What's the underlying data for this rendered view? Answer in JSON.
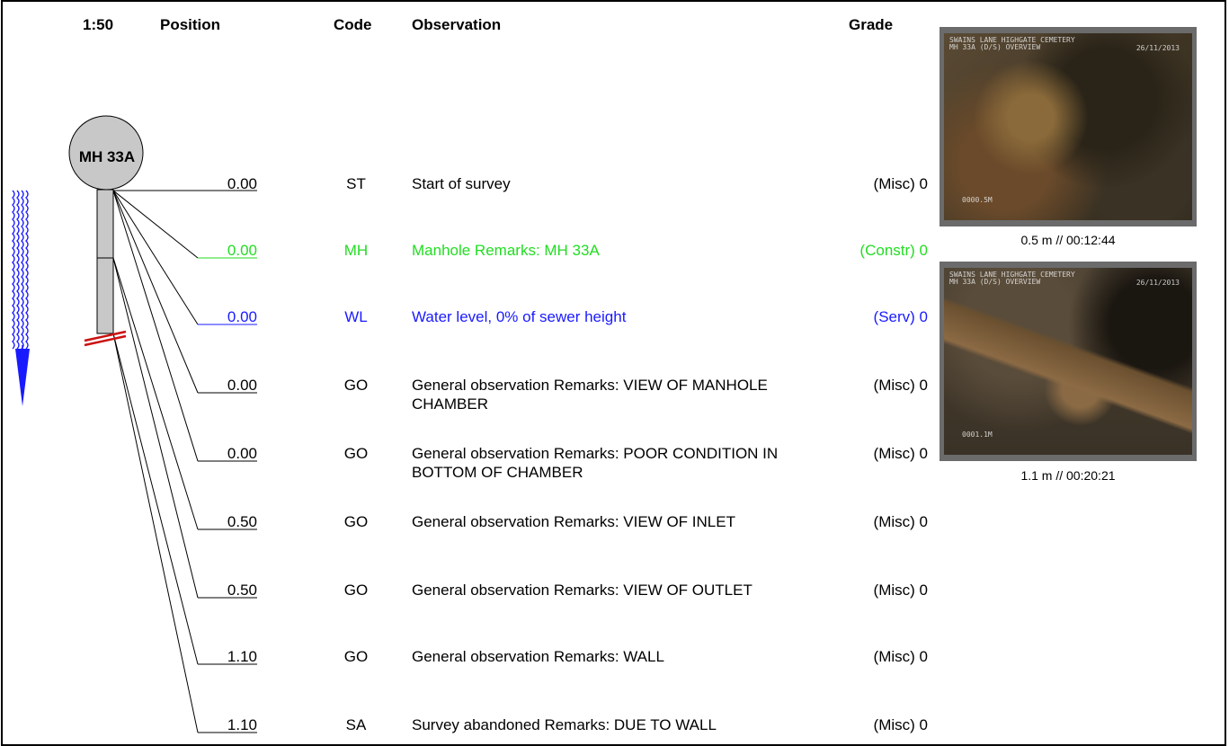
{
  "header": {
    "scale": "1:50",
    "position": "Position",
    "code": "Code",
    "observation": "Observation",
    "grade": "Grade"
  },
  "manhole": {
    "label": "MH 33A"
  },
  "colors": {
    "default": "#000000",
    "constr": "#22dd22",
    "serv": "#1a1aff",
    "flow_arrow": "#1a1aff",
    "pipe_fill": "#c8c8c8",
    "abandon_mark": "#cc1111"
  },
  "rows": [
    {
      "position": "0.00",
      "code": "ST",
      "observation": "Start of survey",
      "grade": "(Misc) 0",
      "color": "default"
    },
    {
      "position": "0.00",
      "code": "MH",
      "observation": "Manhole Remarks: MH 33A",
      "grade": "(Constr) 0",
      "color": "constr"
    },
    {
      "position": "0.00",
      "code": "WL",
      "observation": "Water level, 0% of sewer height",
      "grade": "(Serv) 0",
      "color": "serv"
    },
    {
      "position": "0.00",
      "code": "GO",
      "observation": "General observation Remarks: VIEW OF MANHOLE CHAMBER",
      "grade": "(Misc) 0",
      "color": "default"
    },
    {
      "position": "0.00",
      "code": "GO",
      "observation": "General observation Remarks: POOR CONDITION IN BOTTOM OF CHAMBER",
      "grade": "(Misc) 0",
      "color": "default"
    },
    {
      "position": "0.50",
      "code": "GO",
      "observation": "General observation Remarks: VIEW OF INLET",
      "grade": "(Misc) 0",
      "color": "default"
    },
    {
      "position": "0.50",
      "code": "GO",
      "observation": "General observation Remarks: VIEW OF OUTLET",
      "grade": "(Misc) 0",
      "color": "default"
    },
    {
      "position": "1.10",
      "code": "GO",
      "observation": "General observation Remarks: WALL",
      "grade": "(Misc) 0",
      "color": "default"
    },
    {
      "position": "1.10",
      "code": "SA",
      "observation": "Survey abandoned Remarks: DUE TO WALL",
      "grade": "(Misc) 0",
      "color": "default"
    }
  ],
  "photos": [
    {
      "overlay_line1": "SWAINS LANE HIGHGATE CEMETERY",
      "overlay_line2": "MH 33A (D/S) OVERVIEW",
      "overlay_date": "26/11/2013",
      "overlay_dist": "0000.5M",
      "caption": "0.5 m // 00:12:44"
    },
    {
      "overlay_line1": "SWAINS LANE HIGHGATE CEMETERY",
      "overlay_line2": "MH 33A (D/S) OVERVIEW",
      "overlay_date": "26/11/2013",
      "overlay_dist": "0001.1M",
      "caption": "1.1 m // 00:20:21"
    }
  ]
}
